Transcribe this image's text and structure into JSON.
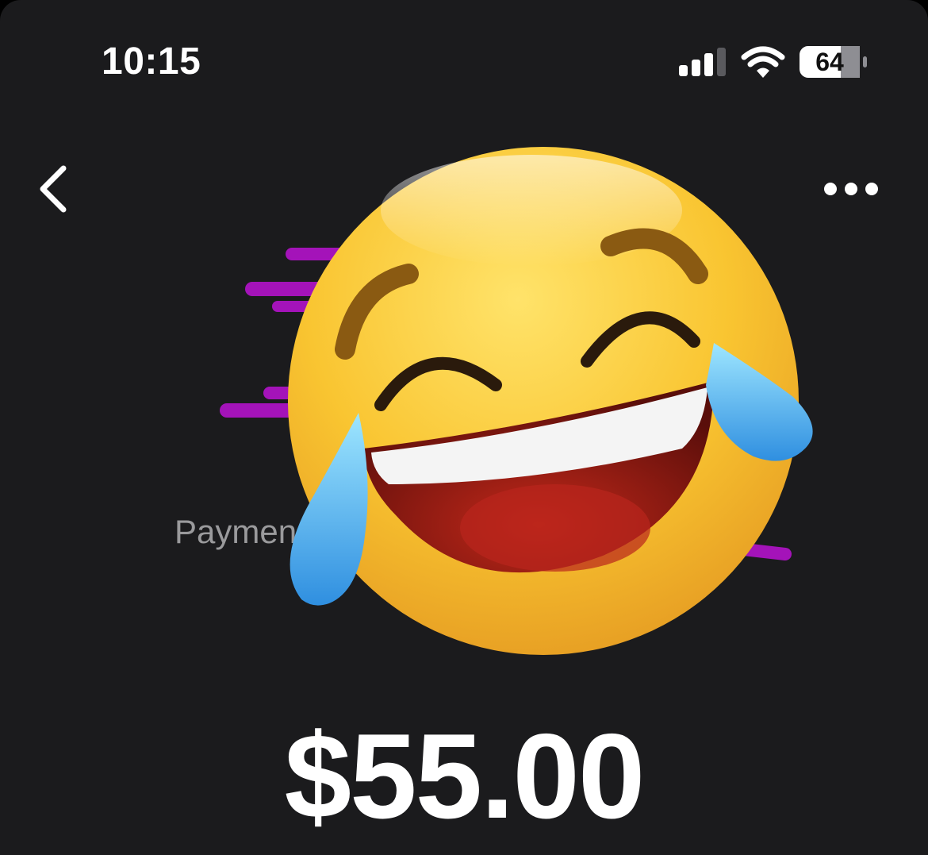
{
  "status_bar": {
    "time": "10:15",
    "battery_level": "64",
    "signal_icon": "cellular-signal-icon",
    "wifi_icon": "wifi-icon"
  },
  "nav": {
    "back_icon": "chevron-left-icon",
    "more_icon": "ellipsis-icon"
  },
  "payment": {
    "label_visible": "Paymen",
    "amount": "$55.00",
    "avatar": "face-with-tears-of-joy-emoji",
    "accent_color": "#a413b9"
  }
}
